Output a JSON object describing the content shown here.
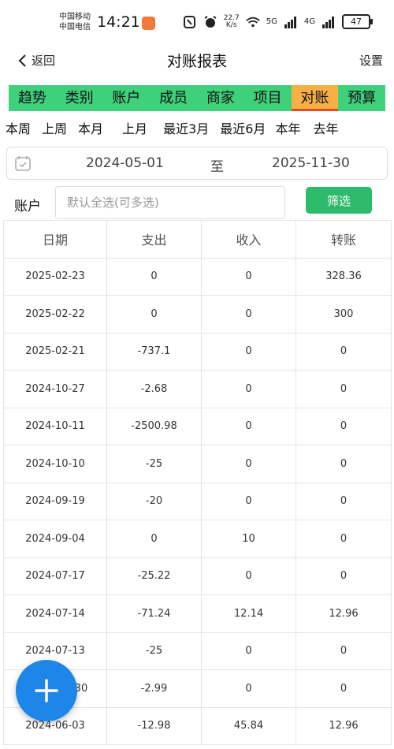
{
  "status_bar": {
    "carrier_1": "中国移动",
    "carrier_2": "中国电信",
    "time": "14:21",
    "net_speed_value": "22.7",
    "net_speed_unit": "K/s",
    "net_5g": "5G",
    "net_4g": "4G",
    "battery": "47"
  },
  "header": {
    "back_label": "返回",
    "title": "对账报表",
    "settings_label": "设置"
  },
  "tabs": [
    {
      "label": "趋势"
    },
    {
      "label": "类别"
    },
    {
      "label": "账户"
    },
    {
      "label": "成员"
    },
    {
      "label": "商家"
    },
    {
      "label": "项目"
    },
    {
      "label": "对账",
      "active": true
    },
    {
      "label": "预算"
    }
  ],
  "periods": [
    "本周",
    "上周",
    "本月",
    "上月",
    "最近3月",
    "最近6月",
    "本年",
    "去年"
  ],
  "date_range": {
    "start": "2024-05-01",
    "separator": "至",
    "end": "2025-11-30"
  },
  "account_filter": {
    "label": "账户",
    "placeholder": "默认全选(可多选)",
    "button_label": "筛选"
  },
  "table": {
    "headers": [
      "日期",
      "支出",
      "收入",
      "转账"
    ],
    "rows": [
      [
        "2025-02-23",
        "0",
        "0",
        "328.36"
      ],
      [
        "2025-02-22",
        "0",
        "0",
        "300"
      ],
      [
        "2025-02-21",
        "-737.1",
        "0",
        "0"
      ],
      [
        "2024-10-27",
        "-2.68",
        "0",
        "0"
      ],
      [
        "2024-10-11",
        "-2500.98",
        "0",
        "0"
      ],
      [
        "2024-10-10",
        "-25",
        "0",
        "0"
      ],
      [
        "2024-09-19",
        "-20",
        "0",
        "0"
      ],
      [
        "2024-09-04",
        "0",
        "10",
        "0"
      ],
      [
        "2024-07-17",
        "-25.22",
        "0",
        "0"
      ],
      [
        "2024-07-14",
        "-71.24",
        "12.14",
        "12.96"
      ],
      [
        "2024-07-13",
        "-25",
        "0",
        "0"
      ],
      [
        "2024-07-?30",
        "-2.99",
        "0",
        "0"
      ],
      [
        "2024-06-03",
        "-12.98",
        "45.84",
        "12.96"
      ]
    ]
  },
  "fab": {
    "icon": "plus-icon"
  },
  "colors": {
    "tab_bar": "#3fd07c",
    "tab_active": "#f6b043",
    "tab_active_underline": "#e24a2a",
    "filter_button": "#2dbb6b",
    "fab": "#1e86e8"
  }
}
